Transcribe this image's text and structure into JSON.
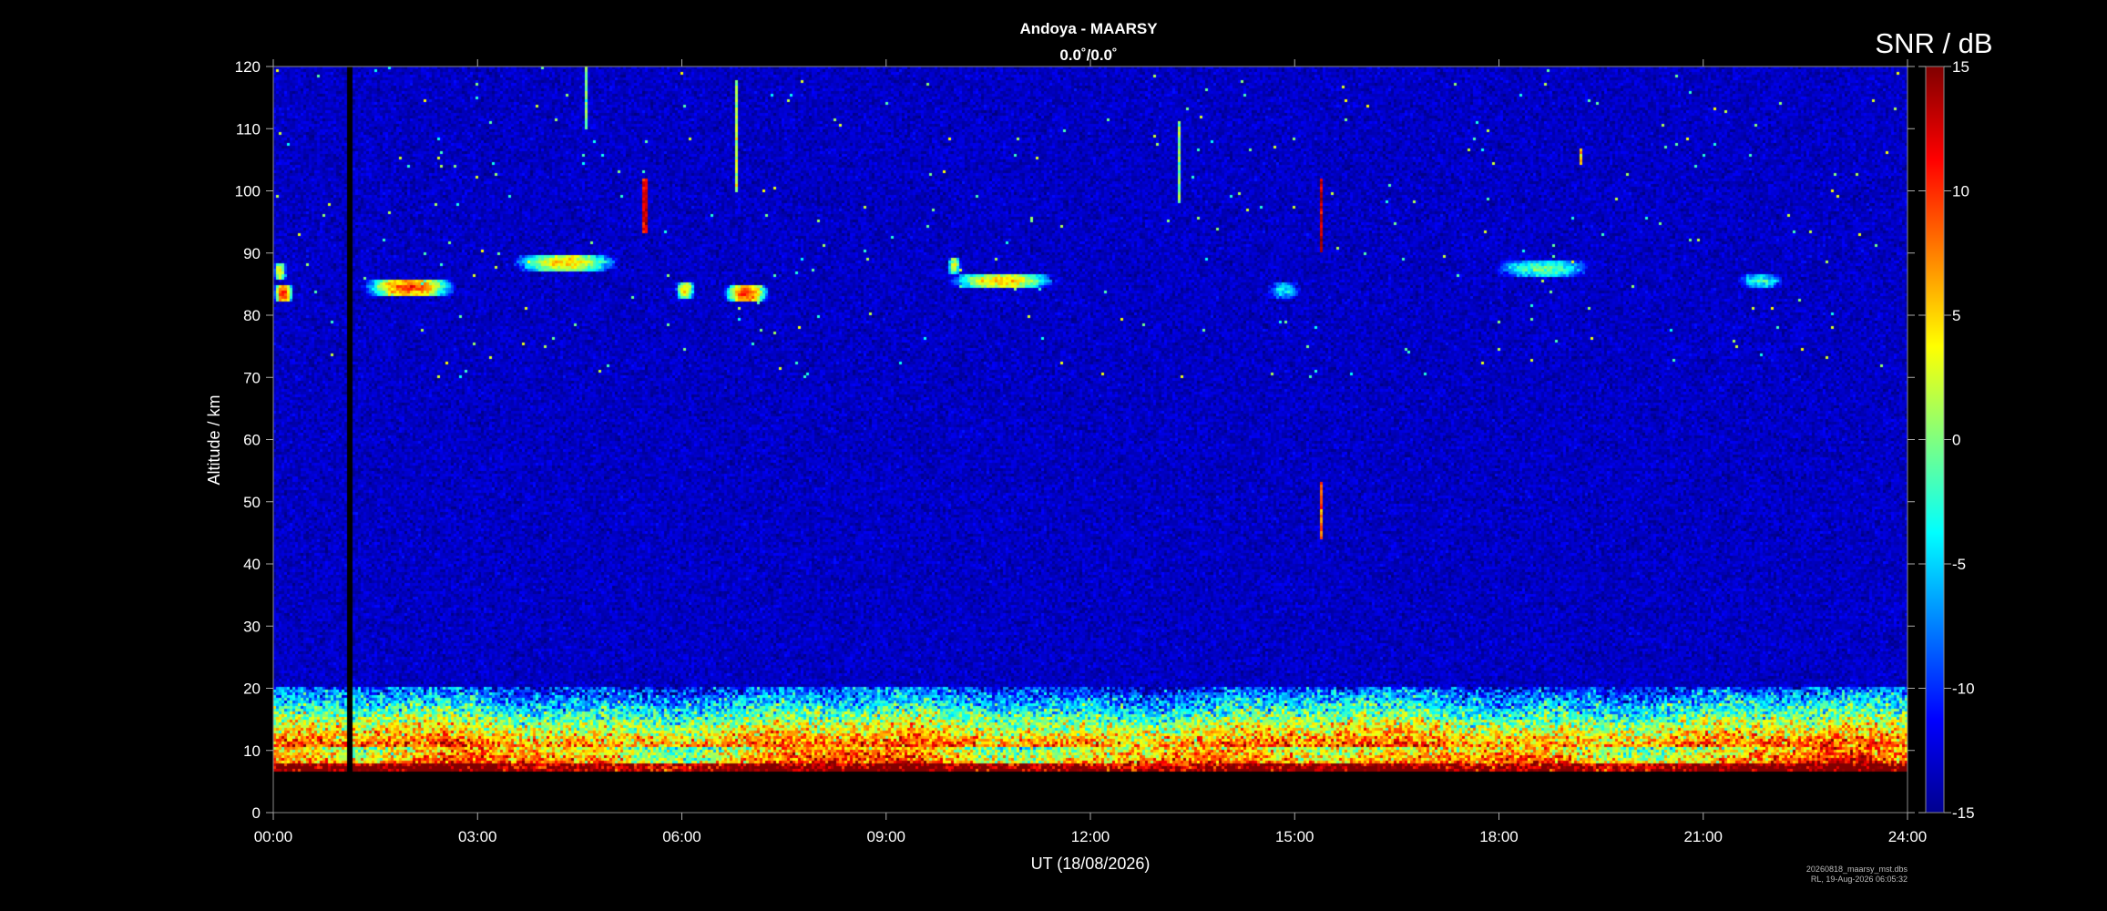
{
  "header": {
    "title": "Andoya - MAARSY",
    "subtitle": "0.0˚/0.0˚"
  },
  "footer": {
    "file_name": "20260818_maarsy_mst.dbs",
    "stamp": "RL, 19-Aug-2026 06:05:32"
  },
  "colorbar": {
    "label": "SNR / dB",
    "ticks": [
      "15",
      "10",
      "5",
      "0",
      "-5",
      "-10",
      "-15"
    ],
    "range": [
      -15,
      15
    ],
    "colormap": "jet"
  },
  "chart_data": {
    "type": "heatmap",
    "title": "Andoya - MAARSY",
    "subtitle": "0.0˚/0.0˚",
    "xlabel": "UT (18/08/2026)",
    "ylabel": "Altitude / km",
    "zlabel": "SNR / dB",
    "xlim": [
      0,
      24
    ],
    "ylim": [
      0,
      120
    ],
    "zlim": [
      -15,
      15
    ],
    "x_tick_labels": [
      "00:00",
      "03:00",
      "06:00",
      "09:00",
      "12:00",
      "15:00",
      "18:00",
      "21:00",
      "24:00"
    ],
    "y_tick_labels": [
      "0",
      "10",
      "20",
      "30",
      "40",
      "50",
      "60",
      "70",
      "80",
      "90",
      "100",
      "110",
      "120"
    ],
    "colormap": "jet",
    "background_snr": -13,
    "data_gap": {
      "start_hour": 1.1,
      "end_hour": 1.15
    },
    "data_lower_altitude": 6.5,
    "tropospheric_layer": {
      "altitude_from": 6.5,
      "altitude_to": 20,
      "snr_range": [
        -10,
        15
      ]
    },
    "pmse_echoes": [
      {
        "start_hour": 0.0,
        "end_hour": 0.3,
        "altitude": 83.5,
        "peak_snr": 12
      },
      {
        "start_hour": 0.0,
        "end_hour": 0.2,
        "altitude": 87,
        "peak_snr": 5
      },
      {
        "start_hour": 1.3,
        "end_hour": 2.7,
        "altitude": 84.5,
        "peak_snr": 10
      },
      {
        "start_hour": 3.5,
        "end_hour": 5.1,
        "altitude": 88.5,
        "peak_snr": 6
      },
      {
        "start_hour": 5.9,
        "end_hour": 6.2,
        "altitude": 84,
        "peak_snr": 6
      },
      {
        "start_hour": 6.6,
        "end_hour": 7.3,
        "altitude": 83.5,
        "peak_snr": 11
      },
      {
        "start_hour": 9.9,
        "end_hour": 11.5,
        "altitude": 85.5,
        "peak_snr": 6
      },
      {
        "start_hour": 9.9,
        "end_hour": 10.1,
        "altitude": 88,
        "peak_snr": 4
      },
      {
        "start_hour": 14.6,
        "end_hour": 15.1,
        "altitude": 84,
        "peak_snr": -3
      },
      {
        "start_hour": 17.9,
        "end_hour": 19.4,
        "altitude": 87.5,
        "peak_snr": 0
      },
      {
        "start_hour": 21.5,
        "end_hour": 22.2,
        "altitude": 85.5,
        "peak_snr": -2
      }
    ],
    "meteor_trails": [
      {
        "hour": 4.6,
        "altitude_from": 110,
        "altitude_to": 120,
        "peak_snr": 0
      },
      {
        "hour": 6.8,
        "altitude_from": 100,
        "altitude_to": 118,
        "peak_snr": 2
      },
      {
        "hour": 5.45,
        "altitude_from": 93,
        "altitude_to": 102,
        "peak_snr": 12
      },
      {
        "hour": 15.4,
        "altitude_from": 90,
        "altitude_to": 102,
        "peak_snr": 13
      },
      {
        "hour": 15.4,
        "altitude_from": 44,
        "altitude_to": 53,
        "peak_snr": 8
      },
      {
        "hour": 13.3,
        "altitude_from": 98,
        "altitude_to": 111,
        "peak_snr": 0
      },
      {
        "hour": 19.2,
        "altitude_from": 104,
        "altitude_to": 107,
        "peak_snr": 5
      }
    ]
  }
}
